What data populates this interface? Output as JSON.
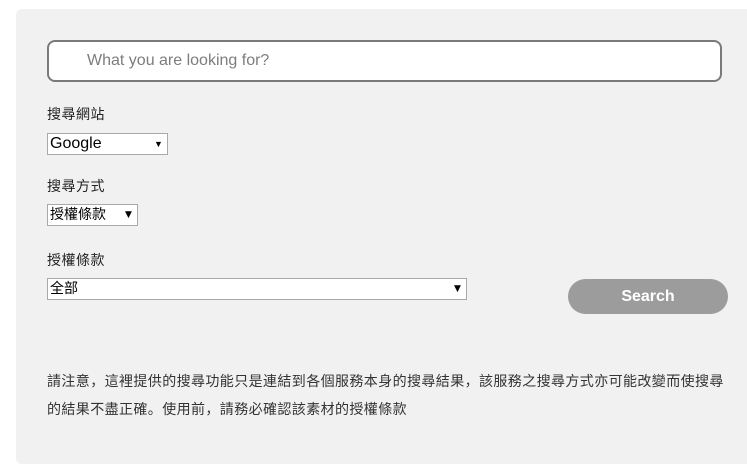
{
  "search": {
    "placeholder": "What you are looking for?",
    "value": ""
  },
  "site_field": {
    "label": "搜尋網站",
    "selected": "Google"
  },
  "method_field": {
    "label": "搜尋方式",
    "selected": "授權條款"
  },
  "license_field": {
    "label": "授權條款",
    "selected": "全部"
  },
  "search_button": {
    "label": "Search"
  },
  "notice": {
    "text": "請注意，這裡提供的搜尋功能只是連結到各個服務本身的搜尋結果，該服務之搜尋方式亦可能改變而使搜尋的結果不盡正確。使用前，請務必確認該素材的授權條款"
  },
  "icons": {
    "dropdown_arrow": "▼"
  },
  "colors": {
    "panel_bg": "#f1f1f1",
    "button_bg": "#9c9c9c",
    "button_text": "#ffffff"
  }
}
